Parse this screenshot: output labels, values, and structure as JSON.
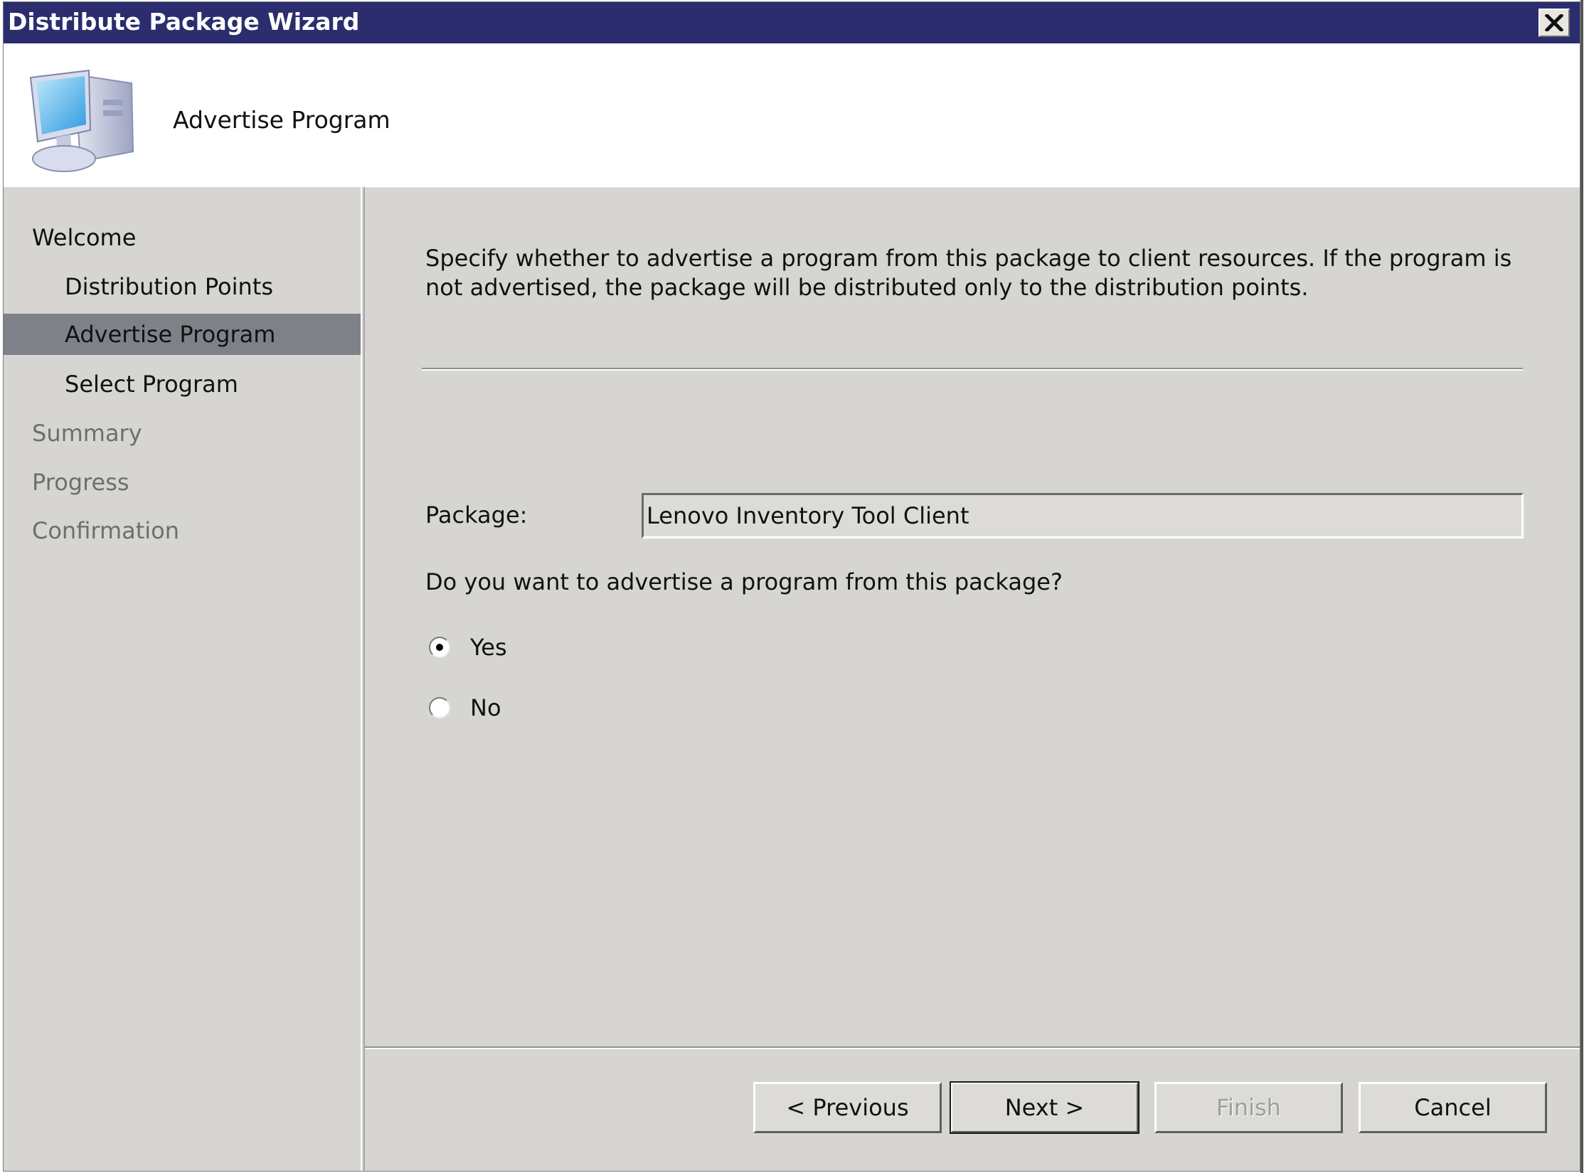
{
  "window": {
    "title": "Distribute Package Wizard",
    "close_icon": "close-icon"
  },
  "header": {
    "icon": "computer-icon",
    "title": "Advertise Program"
  },
  "sidebar": {
    "steps": [
      {
        "label": "Welcome",
        "level": 0,
        "state": "done"
      },
      {
        "label": "Distribution Points",
        "level": 1,
        "state": "done"
      },
      {
        "label": "Advertise Program",
        "level": 1,
        "state": "active"
      },
      {
        "label": "Select Program",
        "level": 1,
        "state": "done"
      },
      {
        "label": "Summary",
        "level": 0,
        "state": "future"
      },
      {
        "label": "Progress",
        "level": 0,
        "state": "future"
      },
      {
        "label": "Confirmation",
        "level": 0,
        "state": "future"
      }
    ]
  },
  "main": {
    "description": "Specify whether to advertise a program from this package to client resources.  If the program is not advertised, the package will be distributed only to the distribution points.",
    "package_label": "Package:",
    "package_value": "Lenovo Inventory Tool Client",
    "question": "Do you want to advertise a program from this package?",
    "options": [
      {
        "label": "Yes",
        "selected": true
      },
      {
        "label": "No",
        "selected": false
      }
    ]
  },
  "buttons": {
    "previous": "< Previous",
    "next": "Next >",
    "finish": "Finish",
    "cancel": "Cancel"
  },
  "colors": {
    "titlebar": "#2b2d6e",
    "active_step": "#7f8189",
    "panel": "#d6d5d1"
  }
}
